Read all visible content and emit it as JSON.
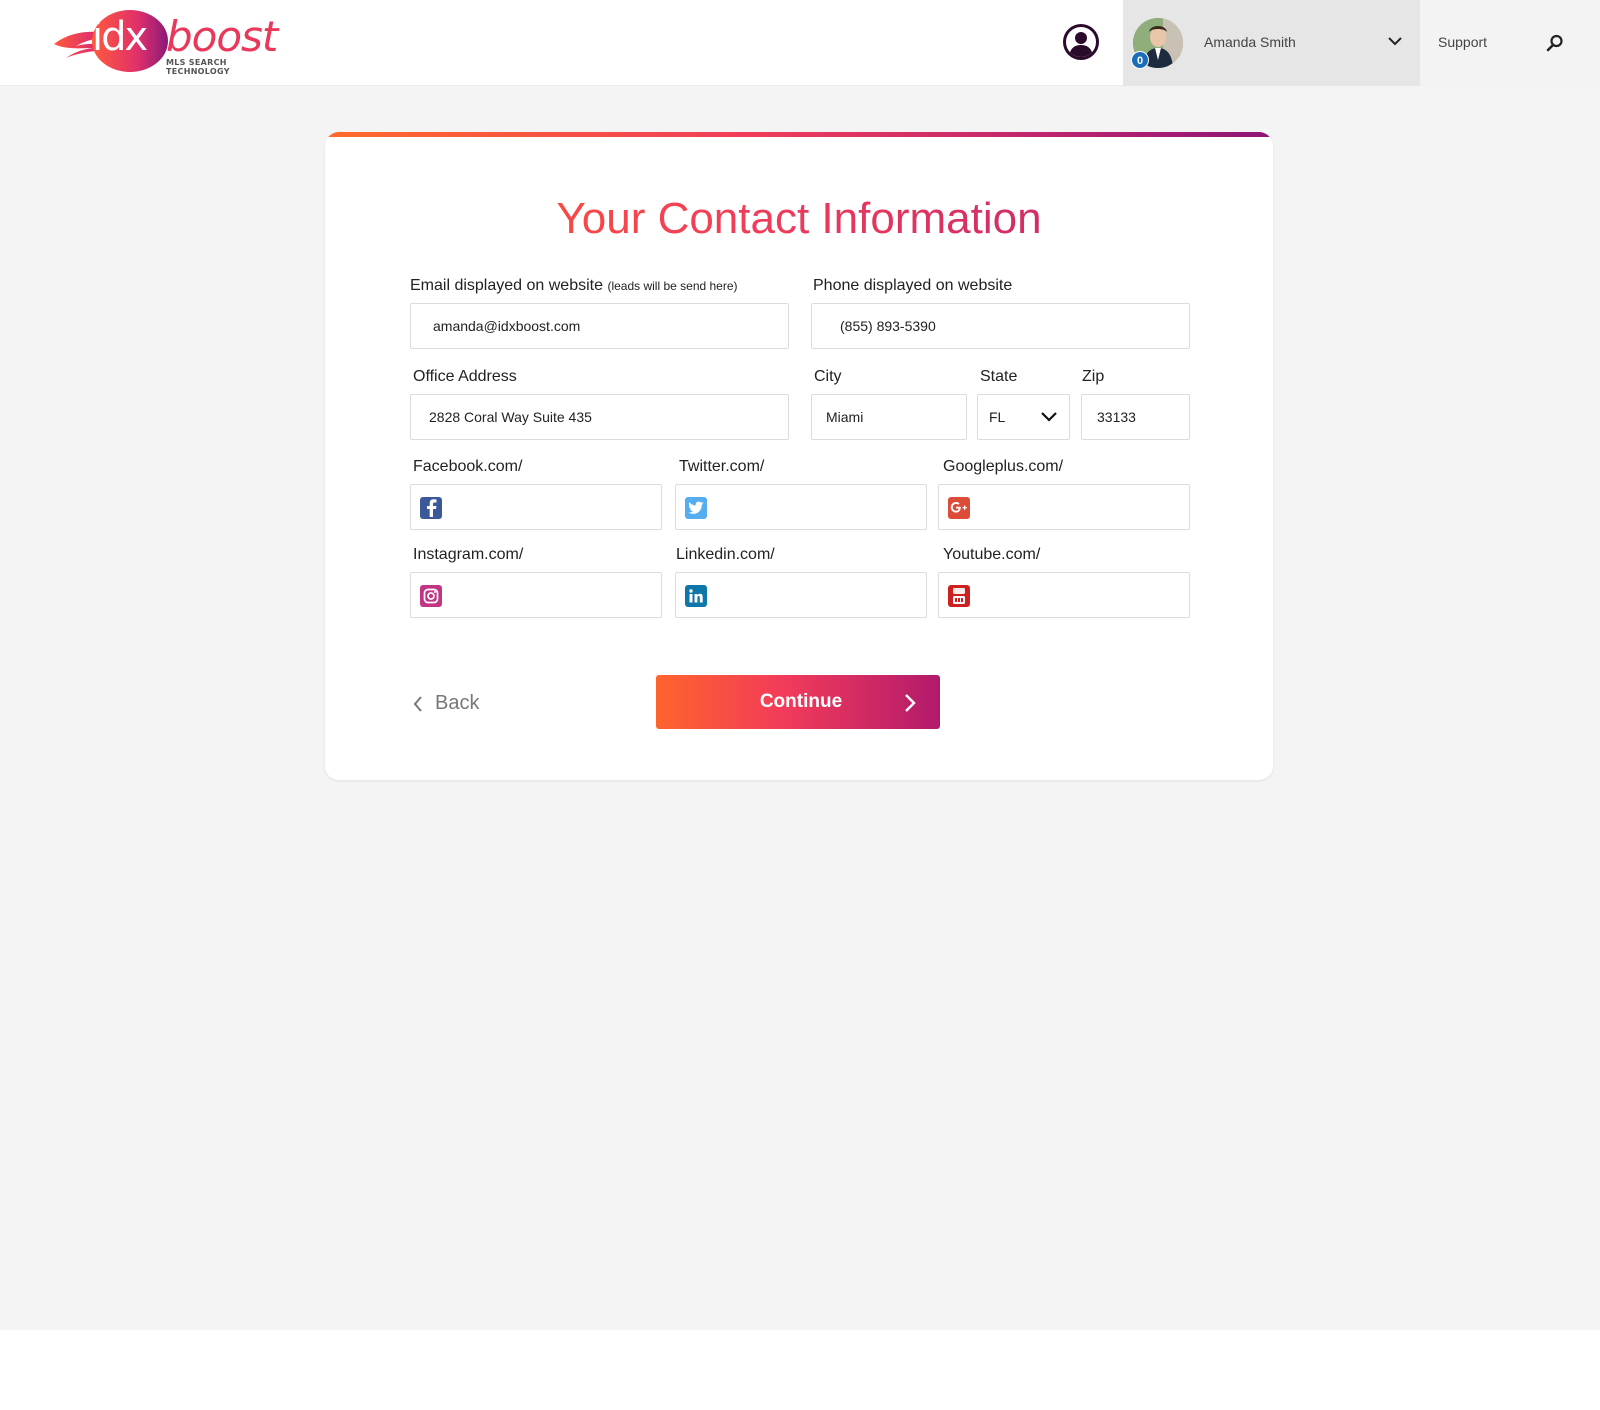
{
  "header": {
    "logo": {
      "idx": "idx",
      "boost": "boost",
      "tagline": "MLS SEARCH TECHNOLOGY"
    },
    "user_name": "Amanda Smith",
    "notification_count": "0",
    "support_label": "Support"
  },
  "form": {
    "title": "Your Contact Information",
    "email": {
      "label": "Email displayed on website",
      "note": "(leads will be send here)",
      "value": "amanda@idxboost.com"
    },
    "phone": {
      "label": "Phone displayed on website",
      "value": "(855) 893-5390"
    },
    "address": {
      "label": "Office Address",
      "value": "2828 Coral Way Suite 435"
    },
    "city": {
      "label": "City",
      "value": "Miami"
    },
    "state": {
      "label": "State",
      "value": "FL"
    },
    "zip": {
      "label": "Zip",
      "value": "33133"
    },
    "social": {
      "facebook": {
        "label": "Facebook.com/",
        "value": ""
      },
      "twitter": {
        "label": "Twitter.com/",
        "value": ""
      },
      "googleplus": {
        "label": "Googleplus.com/",
        "value": ""
      },
      "instagram": {
        "label": "Instagram.com/",
        "value": ""
      },
      "linkedin": {
        "label": "Linkedin.com/",
        "value": ""
      },
      "youtube": {
        "label": "Youtube.com/",
        "value": ""
      }
    },
    "back_label": "Back",
    "continue_label": "Continue"
  },
  "colors": {
    "accent_start": "#ff642c",
    "accent_mid": "#f23b5a",
    "accent_end": "#b21a6c",
    "facebook": "#3b5998",
    "twitter": "#55acee",
    "googleplus": "#dd4b39",
    "instagram": "#c13584",
    "linkedin": "#0e76a8",
    "youtube": "#cd201f"
  },
  "icons": {
    "user": "user-circle-icon",
    "search": "search-icon",
    "chevron": "chevron-down-icon",
    "back": "chevron-left-icon",
    "continue": "chevron-right-icon"
  }
}
